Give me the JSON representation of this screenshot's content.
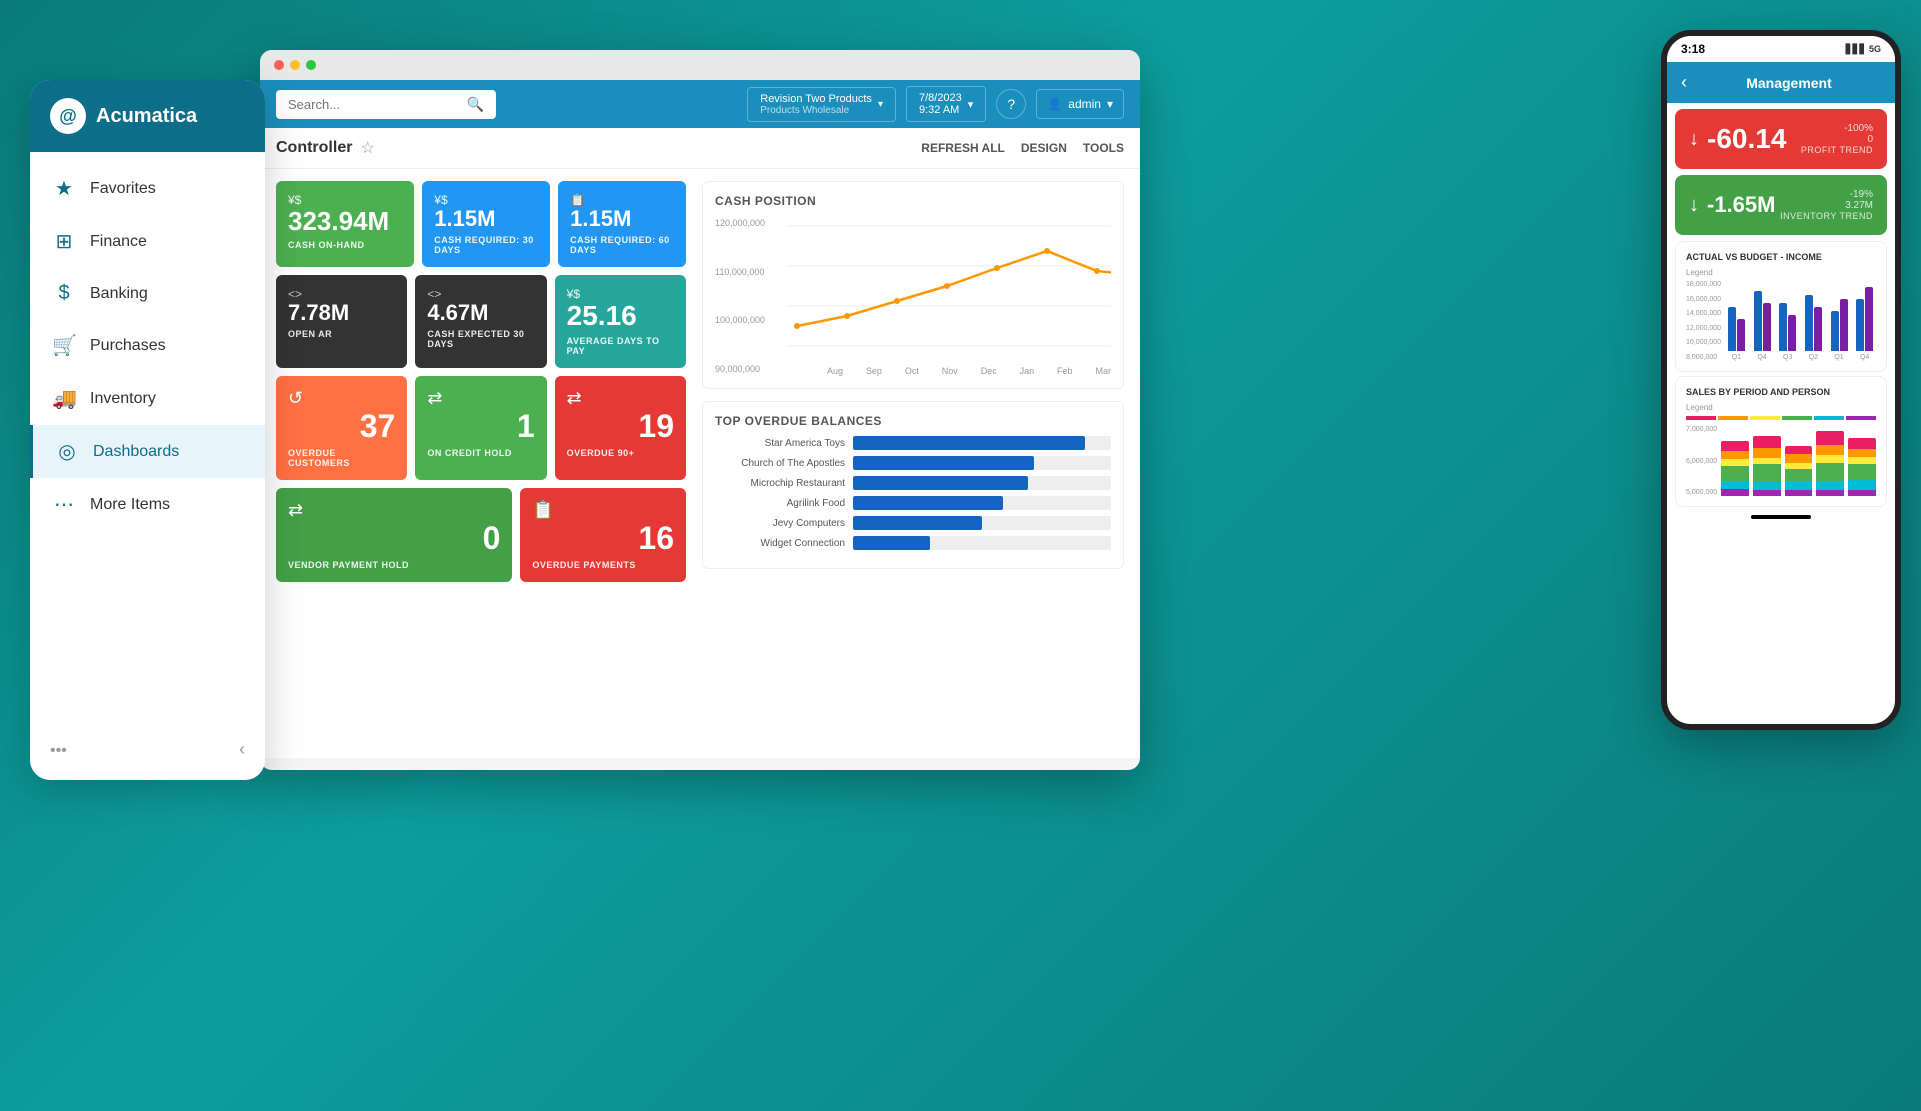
{
  "app": {
    "name": "Acumatica"
  },
  "sidebar": {
    "items": [
      {
        "id": "favorites",
        "label": "Favorites",
        "icon": "★"
      },
      {
        "id": "finance",
        "label": "Finance",
        "icon": "⊞"
      },
      {
        "id": "banking",
        "label": "Banking",
        "icon": "$"
      },
      {
        "id": "purchases",
        "label": "Purchases",
        "icon": "🛒"
      },
      {
        "id": "inventory",
        "label": "Inventory",
        "icon": "🚚"
      },
      {
        "id": "dashboards",
        "label": "Dashboards",
        "icon": "◎",
        "active": true
      },
      {
        "id": "more-items",
        "label": "More Items",
        "icon": "⋯"
      }
    ]
  },
  "browser": {
    "search_placeholder": "Search...",
    "brand": {
      "name": "Revision Two Products",
      "sub": "Products Wholesale"
    },
    "date": {
      "date": "7/8/2023",
      "time": "9:32 AM"
    },
    "admin": "admin"
  },
  "page": {
    "title": "Controller",
    "actions": [
      "REFRESH ALL",
      "DESIGN",
      "TOOLS"
    ]
  },
  "widgets": {
    "cash_on_hand": {
      "value": "323.94M",
      "label": "CASH ON-HAND",
      "currency": "¥$",
      "color": "green"
    },
    "cash_required_30": {
      "value": "1.15M",
      "label": "CASH REQUIRED: 30 DAYS",
      "currency": "¥$",
      "color": "blue"
    },
    "cash_required_60": {
      "value": "1.15M",
      "label": "CASH REQUIRED: 60 DAYS",
      "currency": "📋",
      "color": "blue"
    },
    "open_ar": {
      "value": "7.78M",
      "label": "OPEN AR",
      "currency": "<>",
      "color": "dark"
    },
    "cash_expected_30": {
      "value": "4.67M",
      "label": "CASH EXPECTED 30 DAYS",
      "currency": "<>",
      "color": "dark"
    },
    "avg_days_pay": {
      "value": "25.16",
      "label": "AVERAGE DAYS TO PAY",
      "currency": "¥$",
      "color": "teal"
    },
    "overdue_customers": {
      "value": "37",
      "label": "OVERDUE CUSTOMERS",
      "color": "orange",
      "icon": "↺"
    },
    "credit_hold": {
      "value": "1",
      "label": "ON CREDIT HOLD",
      "color": "green",
      "icon": "⇄"
    },
    "overdue_90": {
      "value": "19",
      "label": "OVERDUE 90+",
      "color": "red",
      "icon": "⇄"
    },
    "vendor_payment_hold": {
      "value": "0",
      "label": "VENDOR PAYMENT HOLD",
      "color": "green2",
      "icon": "⇄"
    },
    "overdue_payments": {
      "value": "16",
      "label": "OVERDUE PAYMENTS",
      "color": "red",
      "icon": "📋"
    }
  },
  "cash_chart": {
    "title": "CASH POSITION",
    "y_labels": [
      "120,000,000",
      "110,000,000",
      "100,000,000",
      "90,000,000"
    ],
    "x_labels": [
      "Aug",
      "Sep",
      "Oct",
      "Nov",
      "Dec",
      "Jan",
      "Feb",
      "Mar"
    ],
    "data_points": [
      95,
      97,
      100,
      103,
      108,
      112,
      107,
      105
    ]
  },
  "overdue_chart": {
    "title": "TOP OVERDUE BALANCES",
    "bars": [
      {
        "label": "Star America Toys",
        "pct": 90
      },
      {
        "label": "Church of The Apostles",
        "pct": 70
      },
      {
        "label": "Microchip Restaurant",
        "pct": 68
      },
      {
        "label": "Agrilink Food",
        "pct": 58
      },
      {
        "label": "Jevy Computers",
        "pct": 50
      },
      {
        "label": "Widget Connection",
        "pct": 30
      }
    ]
  },
  "phone": {
    "time": "3:18",
    "title": "Management",
    "metrics": [
      {
        "value": "-60.14",
        "label": "PROFIT TREND",
        "change": "-100%\n0",
        "color": "red",
        "arrow": "↓"
      },
      {
        "value": "-1.65M",
        "label": "INVENTORY TREND",
        "change": "-19%\n3.27M",
        "color": "green",
        "arrow": "↓"
      }
    ],
    "income_chart": {
      "title": "ACTUAL VS BUDGET - INCOME",
      "y_labels": [
        "18,000,000",
        "16,000,000",
        "14,000,000",
        "12,000,000",
        "10,000,000",
        "8,000,000"
      ],
      "x_labels": [
        "Q1",
        "Q4",
        "Q3",
        "Q2",
        "Q1",
        "Q4"
      ],
      "bars": [
        {
          "actual": 55,
          "budget": 40
        },
        {
          "actual": 75,
          "budget": 60
        },
        {
          "actual": 60,
          "budget": 45
        },
        {
          "actual": 70,
          "budget": 55
        },
        {
          "actual": 50,
          "budget": 65
        },
        {
          "actual": 65,
          "budget": 80
        }
      ]
    },
    "sales_chart": {
      "title": "SALES BY PERIOD AND PERSON",
      "y_labels": [
        "7,000,000",
        "6,000,000",
        "5,000,000"
      ],
      "colors": [
        "#e91e63",
        "#ff9800",
        "#ffeb3b",
        "#4caf50",
        "#00bcd4",
        "#9c27b0"
      ]
    }
  }
}
